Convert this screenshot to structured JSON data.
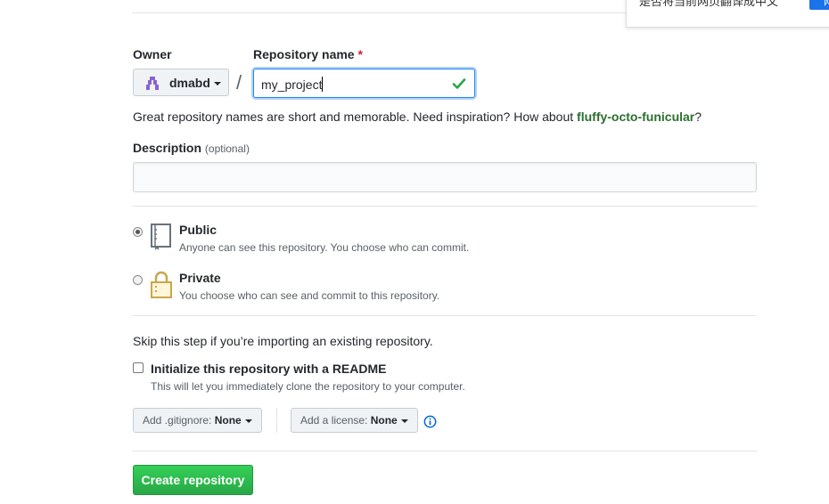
{
  "translate": {
    "text": "是否将当前网页翻译成中文",
    "button_label": "网"
  },
  "owner": {
    "label": "Owner",
    "name": "dmabd"
  },
  "separator": "/",
  "repo": {
    "label": "Repository name",
    "required_mark": "*",
    "value": "my_project"
  },
  "hint": {
    "prefix": "Great repository names are short and memorable. Need inspiration? How about ",
    "suggestion": "fluffy-octo-funicular",
    "suffix": "?"
  },
  "description": {
    "label": "Description",
    "optional": "(optional)",
    "value": ""
  },
  "visibility": {
    "public": {
      "title": "Public",
      "note": "Anyone can see this repository. You choose who can commit.",
      "checked": true
    },
    "private": {
      "title": "Private",
      "note": "You choose who can see and commit to this repository.",
      "checked": false
    }
  },
  "init": {
    "skip_text": "Skip this step if you’re importing an existing repository.",
    "readme_label": "Initialize this repository with a README",
    "readme_note": "This will let you immediately clone the repository to your computer."
  },
  "gitignore": {
    "label": "Add .gitignore:",
    "value": "None"
  },
  "license": {
    "label": "Add a license:",
    "value": "None"
  },
  "create_button": "Create repository",
  "colors": {
    "accent_green": "#28a745",
    "focus_blue": "#2188ff",
    "suggestion": "#2c6e2f"
  }
}
